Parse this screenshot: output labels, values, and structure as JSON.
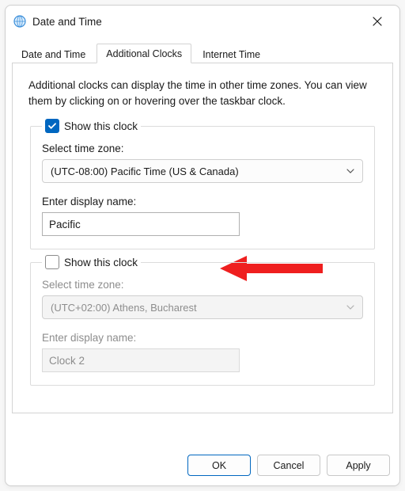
{
  "window": {
    "title": "Date and Time"
  },
  "tabs": {
    "t1": "Date and Time",
    "t2": "Additional Clocks",
    "t3": "Internet Time"
  },
  "intro": "Additional clocks can display the time in other time zones. You can view them by clicking on or hovering over the taskbar clock.",
  "clock1": {
    "show_label": "Show this clock",
    "tz_label": "Select time zone:",
    "tz_value": "(UTC-08:00) Pacific Time (US & Canada)",
    "name_label": "Enter display name:",
    "name_value": "Pacific"
  },
  "clock2": {
    "show_label": "Show this clock",
    "tz_label": "Select time zone:",
    "tz_value": "(UTC+02:00) Athens, Bucharest",
    "name_label": "Enter display name:",
    "name_value": "Clock 2"
  },
  "buttons": {
    "ok": "OK",
    "cancel": "Cancel",
    "apply": "Apply"
  }
}
